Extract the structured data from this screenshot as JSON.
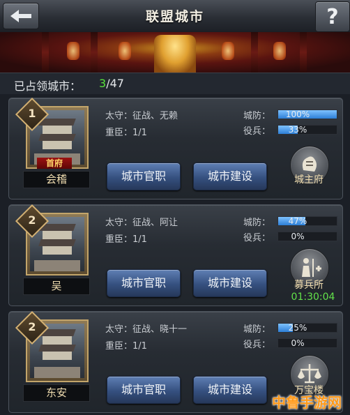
{
  "header": {
    "title": "联盟城市"
  },
  "occupied": {
    "label": "已占领城市：",
    "current": "3",
    "total": "/47"
  },
  "cities": [
    {
      "rank": "1",
      "badge": "首府",
      "name": "会稽",
      "governor": "太守：征战、无赖",
      "minister": "重臣：1/1",
      "defense_label": "城防：",
      "defense_pct": "100%",
      "defense_value": 1.0,
      "troops_label": "役兵：",
      "troops_pct": "33%",
      "troops_value": 0.33,
      "btn_official": "城市官职",
      "btn_build": "城市建设",
      "action_label": "城主府",
      "action_icon": "mansion-icon",
      "timer": ""
    },
    {
      "rank": "2",
      "badge": "",
      "name": "吴",
      "governor": "太守：征战、阿让",
      "minister": "重臣：1/1",
      "defense_label": "城防：",
      "defense_pct": "47%",
      "defense_value": 0.47,
      "troops_label": "役兵：",
      "troops_pct": "0%",
      "troops_value": 0.0,
      "btn_official": "城市官职",
      "btn_build": "城市建设",
      "action_label": "募兵所",
      "action_icon": "recruit-icon",
      "timer": "01:30:04"
    },
    {
      "rank": "2",
      "badge": "",
      "name": "东安",
      "governor": "太守：征战、晓十一",
      "minister": "重臣：1/1",
      "defense_label": "城防：",
      "defense_pct": "25%",
      "defense_value": 0.25,
      "troops_label": "役兵：",
      "troops_pct": "0%",
      "troops_value": 0.0,
      "btn_official": "城市官职",
      "btn_build": "城市建设",
      "action_label": "万宝楼",
      "action_icon": "scales-icon",
      "timer": ""
    }
  ],
  "watermark": "中鲁手游网",
  "colors": {
    "accent_green": "#58e23a",
    "bar_blue": "#2d7fd6",
    "button_blue": "#35507f",
    "gold": "#f0ddb0"
  }
}
